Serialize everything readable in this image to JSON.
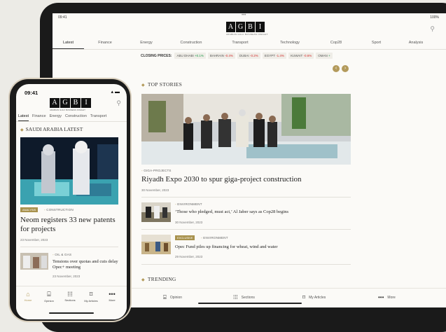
{
  "tablet": {
    "status": {
      "time": "09:41",
      "dots": "•••",
      "battery": "100%"
    },
    "logo": {
      "letters": [
        "A",
        "G",
        "B",
        "I"
      ],
      "subtitle": "ARABIAN GULF BUSINESS INSIGHT"
    },
    "nav": [
      "Latest",
      "Finance",
      "Energy",
      "Construction",
      "Transport",
      "Technology",
      "Cop28",
      "Sport",
      "Analysis"
    ],
    "closing": {
      "label": "CLOSING PRICES:",
      "items": [
        {
          "name": "ABU DHABI",
          "value": "+0.1%",
          "dir": "up"
        },
        {
          "name": "BAHRAIN",
          "value": "-0.4%",
          "dir": "dn"
        },
        {
          "name": "DUBAI",
          "value": "-0.2%",
          "dir": "dn"
        },
        {
          "name": "EGYPT",
          "value": "-1.4%",
          "dir": "dn"
        },
        {
          "name": "KUWAIT",
          "value": "-0.6%",
          "dir": "dn"
        },
        {
          "name": "OMAN",
          "value": "+",
          "dir": "up"
        }
      ]
    },
    "top_stories": "TOP STORIES",
    "hero": {
      "category": "GIGA-PROJECTS",
      "title": "Riyadh Expo 2030 to spur giga-project construction",
      "date": "30 November, 2023"
    },
    "articles": [
      {
        "category": "ENVIRONMENT",
        "badge": "",
        "title": "‘Those who pledged, must act,’ Al Jaber says as Cop28 begins",
        "date": "30 November, 2023"
      },
      {
        "category": "ENVIRONMENT",
        "badge": "EXCLUSIVE",
        "title": "Opec Fund piles up financing for wheat, wind and water",
        "date": "29 November, 2023"
      }
    ],
    "trending": "TRENDING",
    "bottom": [
      "Opinion",
      "Sections",
      "My Articles",
      "More"
    ]
  },
  "phone": {
    "status": {
      "time": "09:41",
      "icons": "▴ ▬"
    },
    "logo": {
      "letters": [
        "A",
        "G",
        "B",
        "I"
      ],
      "subtitle": "ARABIAN GULF BUSINESS INSIGHT"
    },
    "nav": [
      "Latest",
      "Finance",
      "Energy",
      "Construction",
      "Transport"
    ],
    "section": "SAUDI ARABIA LATEST",
    "hero": {
      "badge": "ANALYSIS",
      "category": "CONSTRUCTION",
      "title": "Neom registers 33 new patents for projects",
      "date": "23 November, 2023"
    },
    "article": {
      "category": "OIL & GAS",
      "title": "Tensions over quotas and cuts delay Opec+ meeting",
      "date": "23 November, 2023"
    },
    "bottom": [
      "Home",
      "Opinion",
      "Sections",
      "My Articles",
      "More"
    ]
  },
  "colors": {
    "gold": "#b39a5b",
    "up": "#1e9a4b",
    "down": "#d32d2d"
  }
}
